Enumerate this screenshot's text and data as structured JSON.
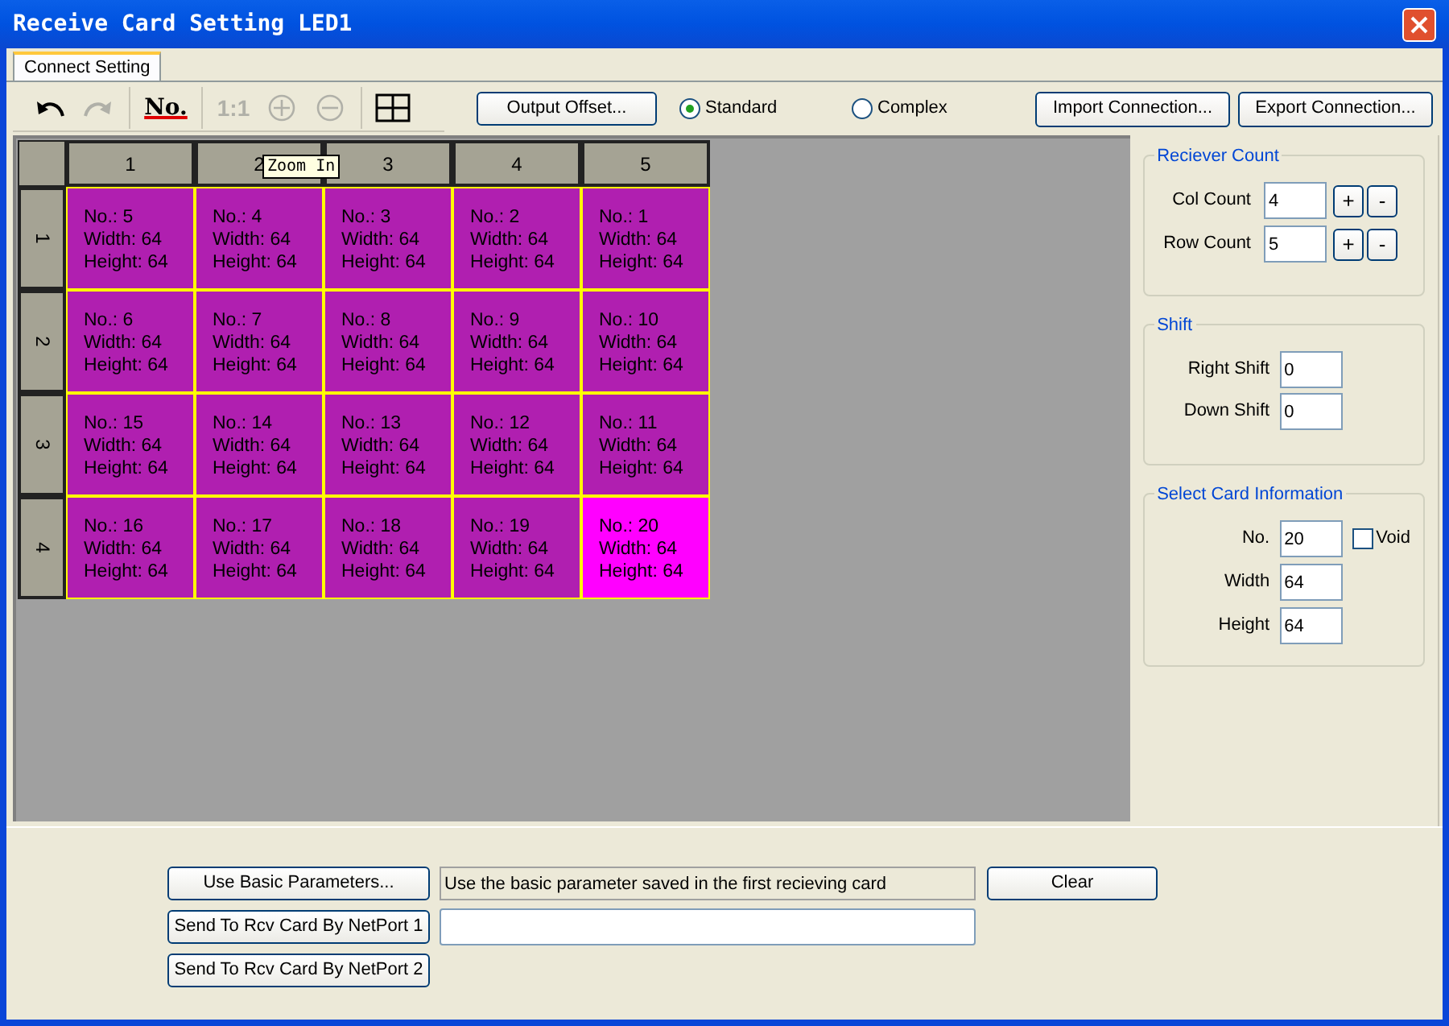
{
  "window": {
    "title": "Receive Card Setting LED1"
  },
  "tabs": [
    {
      "label": "Connect Setting",
      "selected": true
    }
  ],
  "toolbar": [
    {
      "kind": "undo",
      "disabled": false
    },
    {
      "kind": "redo",
      "disabled": true
    },
    {
      "kind": "sep"
    },
    {
      "kind": "numbers",
      "label": "No.",
      "disabled": false
    },
    {
      "kind": "sep"
    },
    {
      "kind": "actual",
      "label": "1:1",
      "disabled": true
    },
    {
      "kind": "zoom_in",
      "disabled": true
    },
    {
      "kind": "zoom_out",
      "disabled": true
    },
    {
      "kind": "sep"
    },
    {
      "kind": "grid",
      "disabled": false
    }
  ],
  "tooltip": "Zoom In",
  "output_offset": "Output Offset...",
  "modes": [
    {
      "label": "Standard",
      "selected": true
    },
    {
      "label": "Complex",
      "selected": false
    }
  ],
  "import_button": "Import Connection...",
  "export_button": "Export Connection...",
  "grid": {
    "columns": [
      "1",
      "2",
      "3",
      "4",
      "5"
    ],
    "rows": [
      {
        "label": "1",
        "cells": [
          {
            "lines": [
              "No.: 5",
              "Width: 64",
              "Height: 64"
            ],
            "selected": false
          },
          {
            "lines": [
              "No.: 4",
              "Width: 64",
              "Height: 64"
            ],
            "selected": false
          },
          {
            "lines": [
              "No.: 3",
              "Width: 64",
              "Height: 64"
            ],
            "selected": false
          },
          {
            "lines": [
              "No.: 2",
              "Width: 64",
              "Height: 64"
            ],
            "selected": false
          },
          {
            "lines": [
              "No.: 1",
              "Width: 64",
              "Height: 64"
            ],
            "selected": false
          }
        ]
      },
      {
        "label": "2",
        "cells": [
          {
            "lines": [
              "No.: 6",
              "Width: 64",
              "Height: 64"
            ],
            "selected": false
          },
          {
            "lines": [
              "No.: 7",
              "Width: 64",
              "Height: 64"
            ],
            "selected": false
          },
          {
            "lines": [
              "No.: 8",
              "Width: 64",
              "Height: 64"
            ],
            "selected": false
          },
          {
            "lines": [
              "No.: 9",
              "Width: 64",
              "Height: 64"
            ],
            "selected": false
          },
          {
            "lines": [
              "No.: 10",
              "Width: 64",
              "Height: 64"
            ],
            "selected": false
          }
        ]
      },
      {
        "label": "3",
        "cells": [
          {
            "lines": [
              "No.: 15",
              "Width: 64",
              "Height: 64"
            ],
            "selected": false
          },
          {
            "lines": [
              "No.: 14",
              "Width: 64",
              "Height: 64"
            ],
            "selected": false
          },
          {
            "lines": [
              "No.: 13",
              "Width: 64",
              "Height: 64"
            ],
            "selected": false
          },
          {
            "lines": [
              "No.: 12",
              "Width: 64",
              "Height: 64"
            ],
            "selected": false
          },
          {
            "lines": [
              "No.: 11",
              "Width: 64",
              "Height: 64"
            ],
            "selected": false
          }
        ]
      },
      {
        "label": "4",
        "cells": [
          {
            "lines": [
              "No.: 16",
              "Width: 64",
              "Height: 64"
            ],
            "selected": false
          },
          {
            "lines": [
              "No.: 17",
              "Width: 64",
              "Height: 64"
            ],
            "selected": false
          },
          {
            "lines": [
              "No.: 18",
              "Width: 64",
              "Height: 64"
            ],
            "selected": false
          },
          {
            "lines": [
              "No.: 19",
              "Width: 64",
              "Height: 64"
            ],
            "selected": false
          },
          {
            "lines": [
              "No.: 20",
              "Width: 64",
              "Height: 64"
            ],
            "selected": true
          }
        ]
      }
    ]
  },
  "receiver_count": {
    "title": "Reciever Count",
    "fields": [
      {
        "label": "Col Count",
        "value": "4",
        "plus": "+",
        "minus": "-"
      },
      {
        "label": "Row Count",
        "value": "5",
        "plus": "+",
        "minus": "-"
      }
    ]
  },
  "shift": {
    "title": "Shift",
    "fields": [
      {
        "label": "Right Shift",
        "value": "0"
      },
      {
        "label": "Down Shift",
        "value": "0"
      }
    ]
  },
  "card_info": {
    "title": "Select Card Information",
    "void": {
      "label": "Void",
      "checked": false
    },
    "fields": [
      {
        "label": "No.",
        "value": "20"
      },
      {
        "label": "Width",
        "value": "64"
      },
      {
        "label": "Height",
        "value": "64"
      }
    ]
  },
  "bottom": {
    "basic_button": "Use Basic Parameters...",
    "basic_note": "Use the basic parameter saved in the first recieving card",
    "clear_button": "Clear",
    "send_buttons": [
      "Send To Rcv Card By NetPort 1",
      "Send To Rcv Card By NetPort 2"
    ]
  }
}
